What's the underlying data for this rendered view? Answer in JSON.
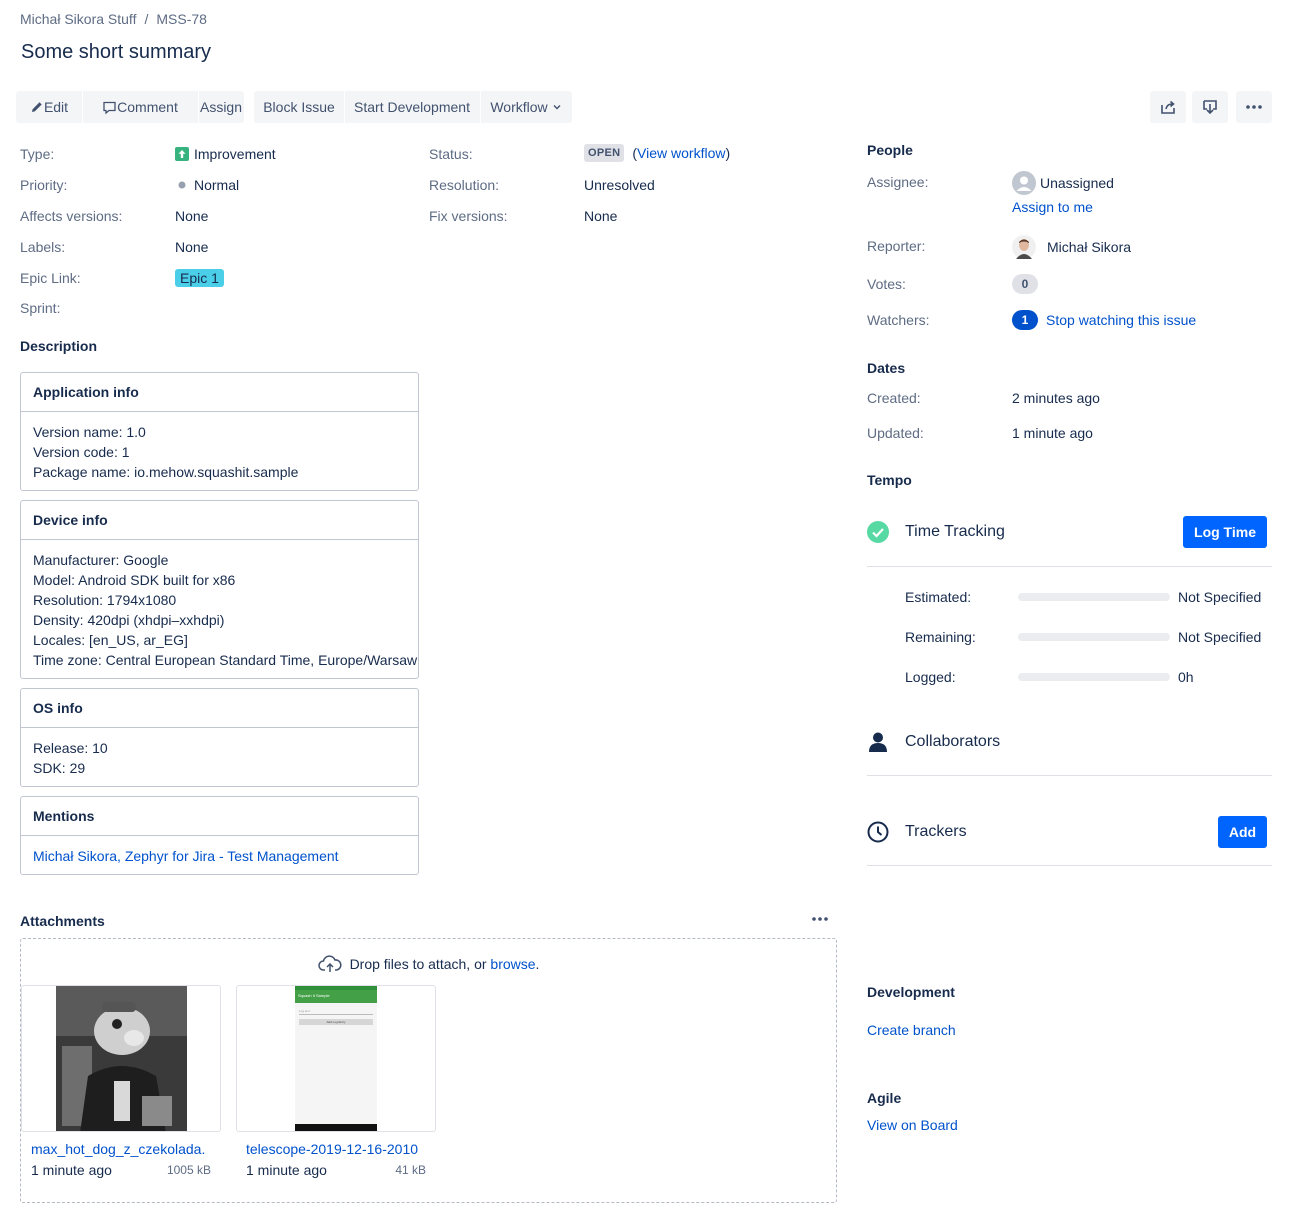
{
  "breadcrumb": {
    "project": "Michał Sikora Stuff",
    "separator": "/",
    "issue_key": "MSS-78"
  },
  "issue": {
    "summary": "Some short summary"
  },
  "toolbar": {
    "edit": "Edit",
    "comment": "Comment",
    "assign": "Assign",
    "block_issue": "Block Issue",
    "start_development": "Start Development",
    "workflow": "Workflow"
  },
  "details": {
    "type_label": "Type:",
    "type_value": "Improvement",
    "priority_label": "Priority:",
    "priority_value": "Normal",
    "affects_label": "Affects versions:",
    "affects_value": "None",
    "labels_label": "Labels:",
    "labels_value": "None",
    "epic_label": "Epic Link:",
    "epic_value": "Epic 1",
    "sprint_label": "Sprint:",
    "status_label": "Status:",
    "status_value": "OPEN",
    "view_workflow_open": "(",
    "view_workflow": "View workflow",
    "view_workflow_close": ")",
    "resolution_label": "Resolution:",
    "resolution_value": "Unresolved",
    "fix_label": "Fix versions:",
    "fix_value": "None"
  },
  "description": {
    "heading": "Description",
    "panels": [
      {
        "title": "Application info",
        "lines": [
          "Version name: 1.0",
          "Version code: 1",
          "Package name: io.mehow.squashit.sample"
        ]
      },
      {
        "title": "Device info",
        "lines": [
          "Manufacturer: Google",
          "Model: Android SDK built for x86",
          "Resolution: 1794x1080",
          "Density: 420dpi (xhdpi–xxhdpi)",
          "Locales: [en_US, ar_EG]",
          "Time zone: Central European Standard Time, Europe/Warsaw"
        ]
      },
      {
        "title": "OS info",
        "lines": [
          "Release: 10",
          "SDK: 29"
        ]
      },
      {
        "title": "Mentions",
        "link1": "Michał Sikora",
        "comma": ", ",
        "link2": "Zephyr for Jira - Test Management"
      }
    ]
  },
  "attachments": {
    "heading": "Attachments",
    "drop_text": "Drop files to attach, or ",
    "browse": "browse",
    "period": ".",
    "items": [
      {
        "name": "max_hot_dog_z_czekolada.p",
        "time": "1 minute ago",
        "size": "1005 kB"
      },
      {
        "name": "telescope-2019-12-16-2010",
        "time": "1 minute ago",
        "size": "41 kB"
      }
    ],
    "phone_screen": {
      "app_title": "Squash It Sample",
      "input_hint": "Log text",
      "button": "Add Log Entry"
    }
  },
  "people": {
    "heading": "People",
    "assignee_label": "Assignee:",
    "assignee_value": "Unassigned",
    "assign_to_me": "Assign to me",
    "reporter_label": "Reporter:",
    "reporter_value": "Michał Sikora",
    "votes_label": "Votes:",
    "votes_count": "0",
    "watchers_label": "Watchers:",
    "watchers_count": "1",
    "stop_watching": "Stop watching this issue"
  },
  "dates": {
    "heading": "Dates",
    "created_label": "Created:",
    "created_value": "2 minutes ago",
    "updated_label": "Updated:",
    "updated_value": "1 minute ago"
  },
  "tempo": {
    "heading": "Tempo",
    "time_tracking": "Time Tracking",
    "log_time": "Log Time",
    "estimated_label": "Estimated:",
    "estimated_value": "Not Specified",
    "remaining_label": "Remaining:",
    "remaining_value": "Not Specified",
    "logged_label": "Logged:",
    "logged_value": "0h",
    "collaborators": "Collaborators",
    "trackers": "Trackers",
    "add": "Add"
  },
  "development": {
    "heading": "Development",
    "create_branch": "Create branch"
  },
  "agile": {
    "heading": "Agile",
    "view_on_board": "View on Board"
  },
  "colors": {
    "link": "#0052cc",
    "primary_button": "#0065ff",
    "epic": "#4bcee8",
    "improvement": "#36b37e",
    "success": "#57d9a3"
  }
}
